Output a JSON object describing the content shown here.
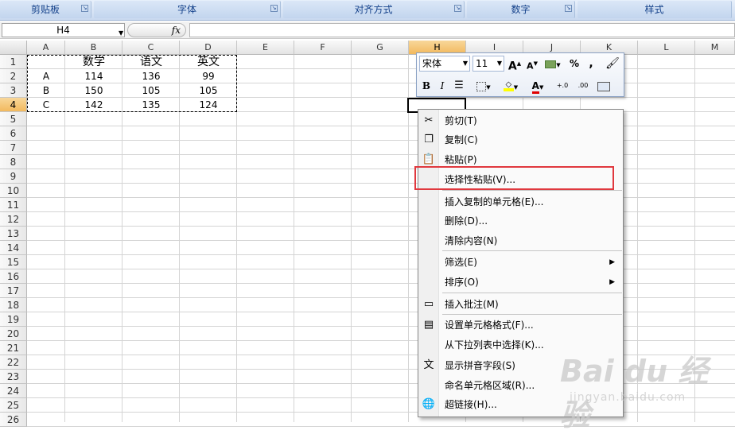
{
  "ribbon": {
    "groups": [
      "剪贴板",
      "字体",
      "对齐方式",
      "数字",
      "样式"
    ]
  },
  "formula_bar": {
    "name_box": "H4",
    "fx_label": "fx",
    "formula": ""
  },
  "columns": [
    "A",
    "B",
    "C",
    "D",
    "E",
    "F",
    "G",
    "H",
    "I",
    "J",
    "K",
    "L",
    "M"
  ],
  "selected_column": "H",
  "rows": [
    "1",
    "2",
    "3",
    "4",
    "5",
    "6",
    "7",
    "8",
    "9",
    "10",
    "11",
    "12",
    "13",
    "14",
    "15",
    "16",
    "17",
    "18",
    "19",
    "20",
    "21",
    "22",
    "23",
    "24",
    "25",
    "26"
  ],
  "selected_row": "4",
  "table": {
    "headers": [
      "",
      "数学",
      "语文",
      "英文"
    ],
    "data": [
      [
        "A",
        "114",
        "136",
        "99"
      ],
      [
        "B",
        "150",
        "105",
        "105"
      ],
      [
        "C",
        "142",
        "135",
        "124"
      ]
    ]
  },
  "mini_toolbar": {
    "font_name": "宋体",
    "font_size": "11",
    "grow_font": "A",
    "shrink_font": "A",
    "percent": "%",
    "comma": ",",
    "bold": "B",
    "italic": "I",
    "font_color": "A",
    "increase_decimal": "+.0",
    "decrease_decimal": ".00"
  },
  "context_menu": {
    "items": [
      {
        "label": "剪切(T)",
        "icon": "scissors-icon"
      },
      {
        "label": "复制(C)",
        "icon": "copy-icon"
      },
      {
        "label": "粘贴(P)",
        "icon": "paste-icon"
      },
      {
        "label": "选择性粘贴(V)...",
        "icon": ""
      },
      {
        "label": "插入复制的单元格(E)...",
        "icon": ""
      },
      {
        "label": "删除(D)...",
        "icon": ""
      },
      {
        "label": "清除内容(N)",
        "icon": ""
      },
      {
        "label": "筛选(E)",
        "icon": "",
        "submenu": true
      },
      {
        "label": "排序(O)",
        "icon": "",
        "submenu": true
      },
      {
        "label": "插入批注(M)",
        "icon": "comment-icon"
      },
      {
        "label": "设置单元格格式(F)...",
        "icon": "format-cells-icon"
      },
      {
        "label": "从下拉列表中选择(K)...",
        "icon": ""
      },
      {
        "label": "显示拼音字段(S)",
        "icon": "phonetic-icon"
      },
      {
        "label": "命名单元格区域(R)...",
        "icon": ""
      },
      {
        "label": "超链接(H)...",
        "icon": "hyperlink-icon"
      }
    ],
    "highlighted_item": "选择性粘贴(V)..."
  },
  "watermark": {
    "brand": "Bai du 经验",
    "url": "jingyan.baidu.com"
  },
  "colors": {
    "highlight_box": "#e0383e",
    "selected_header": "#f2b95e",
    "ribbon_text": "#15428b"
  }
}
